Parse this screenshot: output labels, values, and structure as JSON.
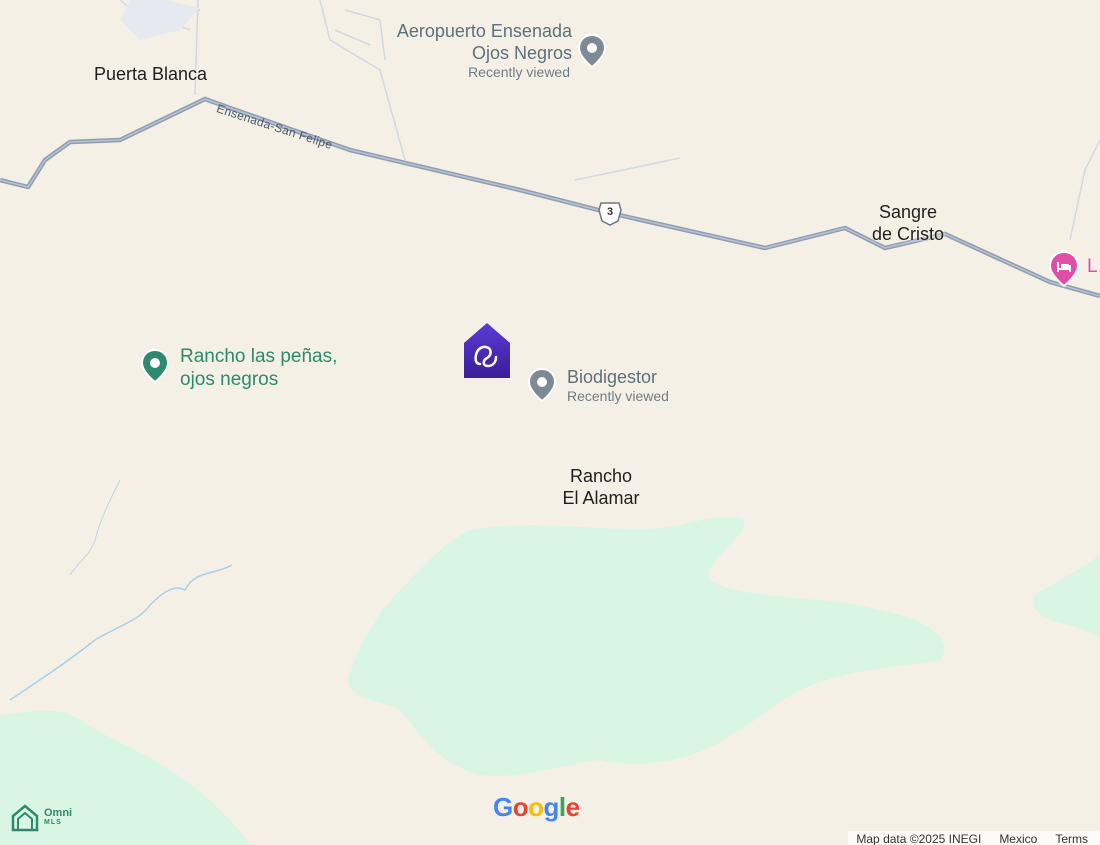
{
  "colors": {
    "land": "#f5f0e6",
    "park": "#d9f5e4",
    "highway": "#8f9db3",
    "poi_gray": "#7c8a96",
    "poi_green": "#2e8a6d",
    "hotel_pink": "#e04fa5",
    "brand_purple": "#4a2bb0"
  },
  "places": {
    "puerta_blanca": "Puerta Blanca",
    "sangre_de_cristo": [
      "Sangre",
      "de Cristo"
    ],
    "rancho_el_alamar": [
      "Rancho",
      "El Alamar"
    ]
  },
  "pois": {
    "airport": {
      "title": [
        "Aeropuerto Ensenada",
        "Ojos Negros"
      ],
      "subtitle": "Recently viewed",
      "icon": "gray-place-pin-icon"
    },
    "biodigestor": {
      "title": "Biodigestor",
      "subtitle": "Recently viewed",
      "icon": "gray-place-pin-icon"
    },
    "rancho_las_penas": {
      "title": [
        "Rancho las peñas,",
        "ojos negros"
      ],
      "icon": "green-place-pin-icon"
    },
    "hotel": {
      "title": "L",
      "icon": "hotel-bed-icon"
    }
  },
  "roads": {
    "highway_name": "Ensenada-San Felipe",
    "shield": "3"
  },
  "listing_marker": {
    "icon": "house-listing-marker-icon"
  },
  "branding": {
    "google": [
      "G",
      "o",
      "o",
      "g",
      "l",
      "e"
    ],
    "google_colors": [
      "#4285F4",
      "#EA4335",
      "#FBBC05",
      "#4285F4",
      "#34A853",
      "#EA4335"
    ],
    "omni_top": "Omni",
    "omni_bottom": "MLS"
  },
  "attribution": {
    "map_data": "Map data ©2025 INEGI",
    "region": "Mexico",
    "terms": "Terms"
  }
}
